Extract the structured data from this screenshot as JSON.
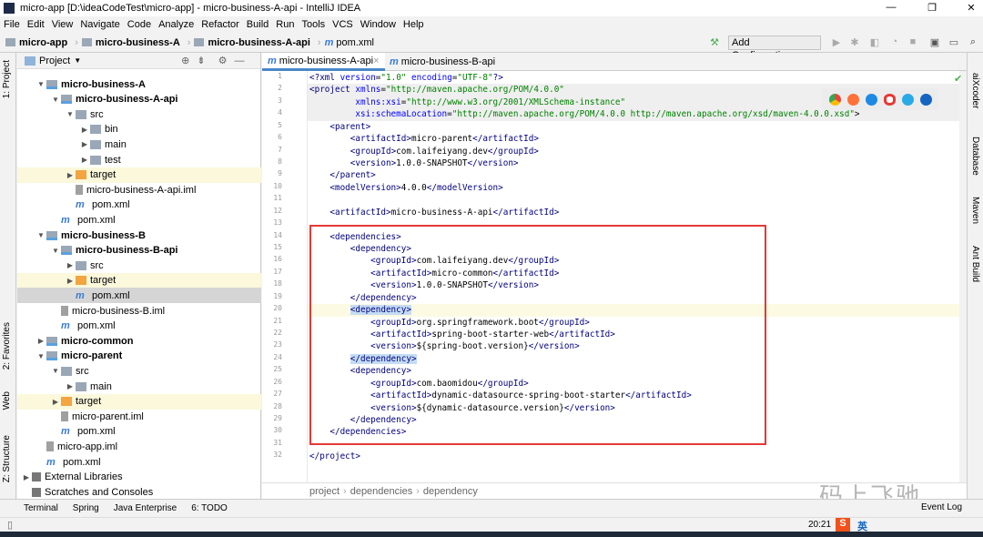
{
  "window": {
    "title": "micro-app [D:\\ideaCodeTest\\micro-app] - micro-business-A-api - IntelliJ IDEA"
  },
  "menu": [
    "File",
    "Edit",
    "View",
    "Navigate",
    "Code",
    "Analyze",
    "Refactor",
    "Build",
    "Run",
    "Tools",
    "VCS",
    "Window",
    "Help"
  ],
  "breadcrumb": [
    "micro-app",
    "micro-business-A",
    "micro-business-A-api",
    "pom.xml"
  ],
  "toolbar": {
    "add_config": "Add Configuration..."
  },
  "left_tabs": [
    "1: Project",
    "2: Favorites",
    "Web",
    "Z: Structure"
  ],
  "right_tabs": [
    "aiXcoder",
    "Database",
    "Maven",
    "Ant Build"
  ],
  "project": {
    "title": "Project",
    "rows": [
      {
        "label": "micro-business-A",
        "depth": 1,
        "exp": "open",
        "icon": "module",
        "bold": true
      },
      {
        "label": "micro-business-A-api",
        "depth": 2,
        "exp": "open",
        "icon": "module",
        "bold": true
      },
      {
        "label": "src",
        "depth": 3,
        "exp": "open",
        "icon": "folder"
      },
      {
        "label": "bin",
        "depth": 4,
        "exp": "closed",
        "icon": "folder"
      },
      {
        "label": "main",
        "depth": 4,
        "exp": "closed",
        "icon": "folder"
      },
      {
        "label": "test",
        "depth": 4,
        "exp": "closed",
        "icon": "folder"
      },
      {
        "label": "target",
        "depth": 3,
        "exp": "closed",
        "icon": "orange",
        "hl": "yellow"
      },
      {
        "label": "micro-business-A-api.iml",
        "depth": 3,
        "icon": "iml"
      },
      {
        "label": "pom.xml",
        "depth": 3,
        "icon": "pom"
      },
      {
        "label": "pom.xml",
        "depth": 2,
        "icon": "pom"
      },
      {
        "label": "micro-business-B",
        "depth": 1,
        "exp": "open",
        "icon": "module",
        "bold": true
      },
      {
        "label": "micro-business-B-api",
        "depth": 2,
        "exp": "open",
        "icon": "module",
        "bold": true
      },
      {
        "label": "src",
        "depth": 3,
        "exp": "closed",
        "icon": "folder"
      },
      {
        "label": "target",
        "depth": 3,
        "exp": "closed",
        "icon": "orange",
        "hl": "yellow"
      },
      {
        "label": "pom.xml",
        "depth": 3,
        "icon": "pom",
        "hl": "sel"
      },
      {
        "label": "micro-business-B.iml",
        "depth": 2,
        "icon": "iml"
      },
      {
        "label": "pom.xml",
        "depth": 2,
        "icon": "pom"
      },
      {
        "label": "micro-common",
        "depth": 1,
        "exp": "closed",
        "icon": "module",
        "bold": true
      },
      {
        "label": "micro-parent",
        "depth": 1,
        "exp": "open",
        "icon": "module",
        "bold": true
      },
      {
        "label": "src",
        "depth": 2,
        "exp": "open",
        "icon": "folder"
      },
      {
        "label": "main",
        "depth": 3,
        "exp": "closed",
        "icon": "folder"
      },
      {
        "label": "target",
        "depth": 2,
        "exp": "closed",
        "icon": "orange",
        "hl": "yellow"
      },
      {
        "label": "micro-parent.iml",
        "depth": 2,
        "icon": "iml"
      },
      {
        "label": "pom.xml",
        "depth": 2,
        "icon": "pom"
      },
      {
        "label": "micro-app.iml",
        "depth": 1,
        "icon": "iml"
      },
      {
        "label": "pom.xml",
        "depth": 1,
        "icon": "pom"
      },
      {
        "label": "External Libraries",
        "depth": 0,
        "exp": "closed",
        "icon": "lib"
      },
      {
        "label": "Scratches and Consoles",
        "depth": 0,
        "icon": "lib"
      }
    ]
  },
  "editor_tabs": [
    {
      "label": "micro-business-A-api",
      "active": true
    },
    {
      "label": "micro-business-B-api",
      "active": false
    }
  ],
  "code": [
    "<?xml version=\"1.0\" encoding=\"UTF-8\"?>",
    "<project xmlns=\"http://maven.apache.org/POM/4.0.0\"",
    "         xmlns:xsi=\"http://www.w3.org/2001/XMLSchema-instance\"",
    "         xsi:schemaLocation=\"http://maven.apache.org/POM/4.0.0 http://maven.apache.org/xsd/maven-4.0.0.xsd\">",
    "    <parent>",
    "        <artifactId>micro-parent</artifactId>",
    "        <groupId>com.laifeiyang.dev</groupId>",
    "        <version>1.0.0-SNAPSHOT</version>",
    "    </parent>",
    "    <modelVersion>4.0.0</modelVersion>",
    "",
    "    <artifactId>micro-business-A-api</artifactId>",
    "",
    "    <dependencies>",
    "        <dependency>",
    "            <groupId>com.laifeiyang.dev</groupId>",
    "            <artifactId>micro-common</artifactId>",
    "            <version>1.0.0-SNAPSHOT</version>",
    "        </dependency>",
    "        <dependency>",
    "            <groupId>org.springframework.boot</groupId>",
    "            <artifactId>spring-boot-starter-web</artifactId>",
    "            <version>${spring-boot.version}</version>",
    "        </dependency>",
    "        <dependency>",
    "            <groupId>com.baomidou</groupId>",
    "            <artifactId>dynamic-datasource-spring-boot-starter</artifactId>",
    "            <version>${dynamic-datasource.version}</version>",
    "        </dependency>",
    "    </dependencies>",
    "",
    "</project>"
  ],
  "current_line": 20,
  "editor_breadcrumb": [
    "project",
    "dependencies",
    "dependency"
  ],
  "bottom_tools": [
    "Terminal",
    "Spring",
    "Java Enterprise",
    "6: TODO"
  ],
  "status": {
    "event_log": "Event Log",
    "time": "20:21",
    "ime": "英"
  },
  "watermark": "码上飞驰",
  "colors": {
    "accent": "#4a88c7",
    "highlight_box": "#e53935",
    "tag": "#000080",
    "attr_value": "#008000"
  }
}
